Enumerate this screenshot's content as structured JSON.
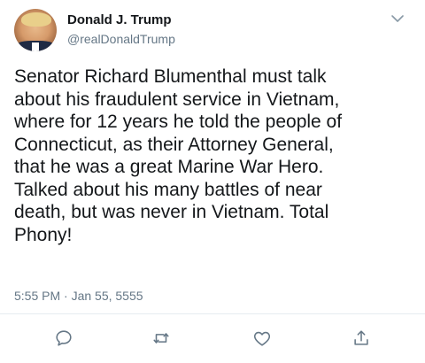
{
  "author": {
    "name": "Donald J. Trump",
    "handle": "@realDonaldTrump"
  },
  "tweet": {
    "text": "Senator Richard Blumenthal must talk\nabout his fraudulent service in Vietnam,\nwhere for 12 years he told the people of\nConnecticut, as their Attorney General,\nthat he was a great Marine War Hero.\nTalked about his many battles of near\ndeath, but was never in Vietnam. Total\nPhony!",
    "timestamp": "5:55 PM · Jan 55, 5555"
  },
  "icons": {
    "menu": "chevron-down-icon",
    "reply": "reply-icon",
    "retweet": "retweet-icon",
    "like": "heart-icon",
    "share": "share-icon"
  },
  "colors": {
    "text": "#14171a",
    "secondary": "#657786",
    "divider": "#e6ecf0"
  }
}
